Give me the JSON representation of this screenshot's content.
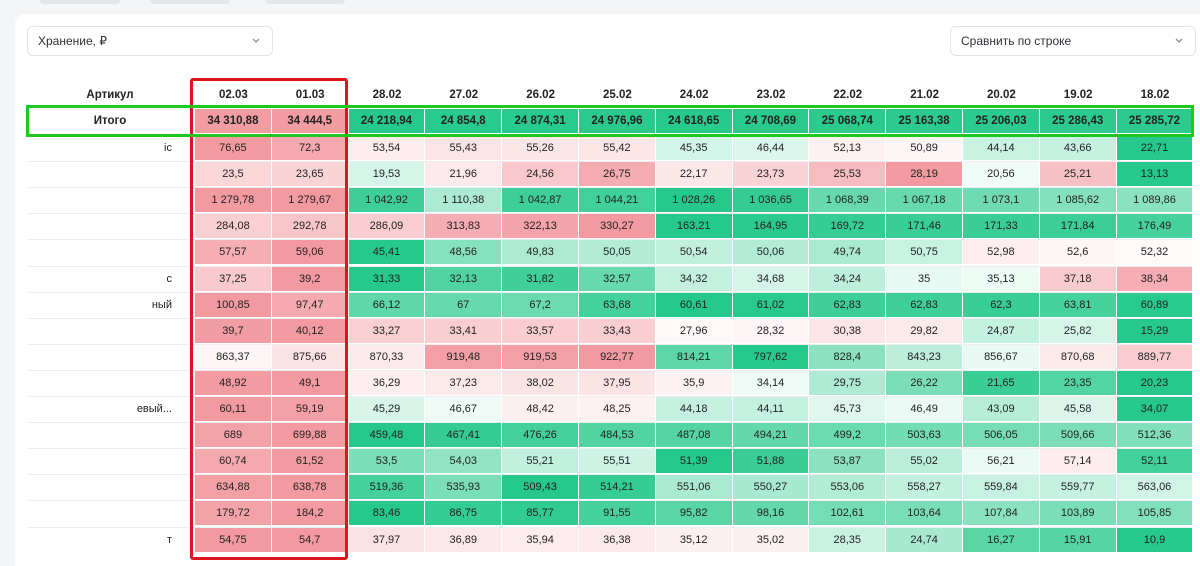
{
  "filters": {
    "metric_select": "Хранение, ₽",
    "compare_select": "Сравнить по строке"
  },
  "table": {
    "header_article": "Артикул",
    "total_label": "Итого",
    "dates": [
      "02.03",
      "01.03",
      "28.02",
      "27.02",
      "26.02",
      "25.02",
      "24.02",
      "23.02",
      "22.02",
      "21.02",
      "20.02",
      "19.02",
      "18.02"
    ],
    "totals": [
      "34 310,88",
      "34 444,5",
      "24 218,94",
      "24 854,8",
      "24 874,31",
      "24 976,96",
      "24 618,65",
      "24 708,69",
      "25 068,74",
      "25 163,38",
      "25 206,03",
      "25 286,43",
      "25 285,72"
    ],
    "rows": [
      {
        "label": "іс",
        "values": [
          "76,65",
          "72,3",
          "53,54",
          "55,43",
          "55,26",
          "55,42",
          "45,35",
          "46,44",
          "52,13",
          "50,89",
          "44,14",
          "43,66",
          "22,71"
        ]
      },
      {
        "label": "",
        "values": [
          "23,5",
          "23,65",
          "19,53",
          "21,96",
          "24,56",
          "26,75",
          "22,17",
          "23,73",
          "25,53",
          "28,19",
          "20,56",
          "25,21",
          "13,13"
        ]
      },
      {
        "label": "",
        "values": [
          "1 279,78",
          "1 279,67",
          "1 042,92",
          "1 110,38",
          "1 042,87",
          "1 044,21",
          "1 028,26",
          "1 036,65",
          "1 068,39",
          "1 067,18",
          "1 073,1",
          "1 085,62",
          "1 089,86"
        ]
      },
      {
        "label": "",
        "values": [
          "284,08",
          "292,78",
          "286,09",
          "313,83",
          "322,13",
          "330,27",
          "163,21",
          "164,95",
          "169,72",
          "171,46",
          "171,33",
          "171,84",
          "176,49"
        ]
      },
      {
        "label": "",
        "values": [
          "57,57",
          "59,06",
          "45,41",
          "48,56",
          "49,83",
          "50,05",
          "50,54",
          "50,06",
          "49,74",
          "50,75",
          "52,98",
          "52,6",
          "52,32"
        ]
      },
      {
        "label": "с",
        "values": [
          "37,25",
          "39,2",
          "31,33",
          "32,13",
          "31,82",
          "32,57",
          "34,32",
          "34,68",
          "34,24",
          "35",
          "35,13",
          "37,18",
          "38,34"
        ]
      },
      {
        "label": "ный",
        "values": [
          "100,85",
          "97,47",
          "66,12",
          "67",
          "67,2",
          "63,68",
          "60,61",
          "61,02",
          "62,83",
          "62,83",
          "62,3",
          "63,81",
          "60,89"
        ]
      },
      {
        "label": "",
        "values": [
          "39,7",
          "40,12",
          "33,27",
          "33,41",
          "33,57",
          "33,43",
          "27,96",
          "28,32",
          "30,38",
          "29,82",
          "24,87",
          "25,82",
          "15,29"
        ]
      },
      {
        "label": "",
        "values": [
          "863,37",
          "875,66",
          "870,33",
          "919,48",
          "919,53",
          "922,77",
          "814,21",
          "797,62",
          "828,4",
          "843,23",
          "856,67",
          "870,68",
          "889,77"
        ]
      },
      {
        "label": "",
        "values": [
          "48,92",
          "49,1",
          "36,29",
          "37,23",
          "38,02",
          "37,95",
          "35,9",
          "34,14",
          "29,75",
          "26,22",
          "21,65",
          "23,35",
          "20,23"
        ]
      },
      {
        "label": "евый...",
        "values": [
          "60,11",
          "59,19",
          "45,29",
          "46,67",
          "48,42",
          "48,25",
          "44,18",
          "44,11",
          "45,73",
          "46,49",
          "43,09",
          "45,58",
          "34,07"
        ]
      },
      {
        "label": "",
        "values": [
          "689",
          "699,88",
          "459,48",
          "467,41",
          "476,26",
          "484,53",
          "487,08",
          "494,21",
          "499,2",
          "503,63",
          "506,05",
          "509,66",
          "512,36"
        ]
      },
      {
        "label": "",
        "values": [
          "60,74",
          "61,52",
          "53,5",
          "54,03",
          "55,21",
          "55,51",
          "51,39",
          "51,88",
          "53,87",
          "55,02",
          "56,21",
          "57,14",
          "52,11"
        ]
      },
      {
        "label": "",
        "values": [
          "634,88",
          "638,78",
          "519,36",
          "535,93",
          "509,43",
          "514,21",
          "551,06",
          "550,27",
          "553,06",
          "558,27",
          "559,84",
          "559,77",
          "563,06"
        ]
      },
      {
        "label": "",
        "values": [
          "179,72",
          "184,2",
          "83,46",
          "86,75",
          "85,77",
          "91,55",
          "95,82",
          "98,16",
          "102,61",
          "103,64",
          "107,84",
          "103,89",
          "105,85"
        ]
      },
      {
        "label": "т",
        "values": [
          "54,75",
          "54,7",
          "37,97",
          "36,89",
          "35,94",
          "36,38",
          "35,12",
          "35,02",
          "28,35",
          "24,74",
          "16,27",
          "15,91",
          "10,9"
        ]
      }
    ]
  },
  "colors": {
    "red_strong": "#f29a9f",
    "green_strong": "#26c98b",
    "highlight_red": "#e0141e",
    "highlight_green": "#1ec81e"
  }
}
